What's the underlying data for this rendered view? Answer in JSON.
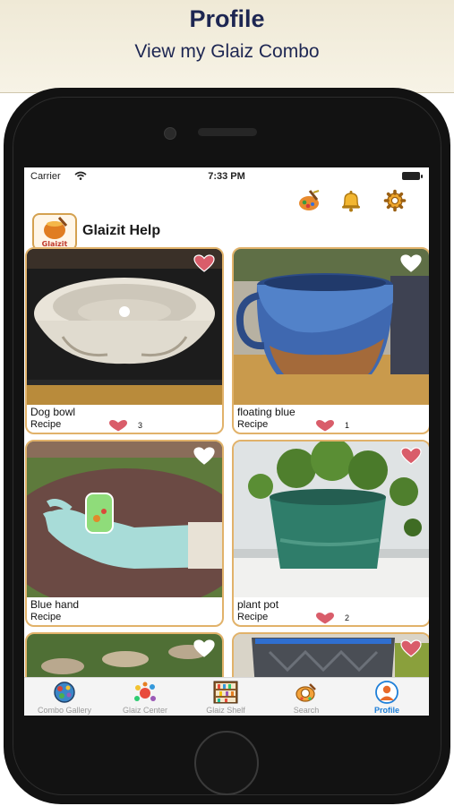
{
  "banner": {
    "title": "Profile",
    "subtitle": "View my Glaiz Combo"
  },
  "status_bar": {
    "carrier": "Carrier",
    "time": "7:33 PM"
  },
  "header": {
    "help_title": "Glaizit Help",
    "logo_text": "Glaizit",
    "icons": [
      "palette-icon",
      "bell-icon",
      "gear-icon"
    ]
  },
  "cards": [
    {
      "name": "Dog bowl",
      "recipe_label": "Recipe",
      "likes": "3"
    },
    {
      "name": "floating blue",
      "recipe_label": "Recipe",
      "likes": "1"
    },
    {
      "name": "Blue hand",
      "recipe_label": "Recipe",
      "likes": ""
    },
    {
      "name": "plant pot",
      "recipe_label": "Recipe",
      "likes": "2"
    }
  ],
  "tabs": [
    {
      "label": "Combo Gallery",
      "icon": "globe-icon"
    },
    {
      "label": "Glaiz Center",
      "icon": "splash-icon"
    },
    {
      "label": "Glaiz Shelf",
      "icon": "shelf-icon"
    },
    {
      "label": "Search",
      "icon": "search-icon"
    },
    {
      "label": "Profile",
      "icon": "profile-icon",
      "active": true
    }
  ],
  "colors": {
    "card_border": "#e1b26a",
    "heart": "#d95d6a",
    "active_tab": "#1e7fd8",
    "banner_text": "#1d2652"
  }
}
